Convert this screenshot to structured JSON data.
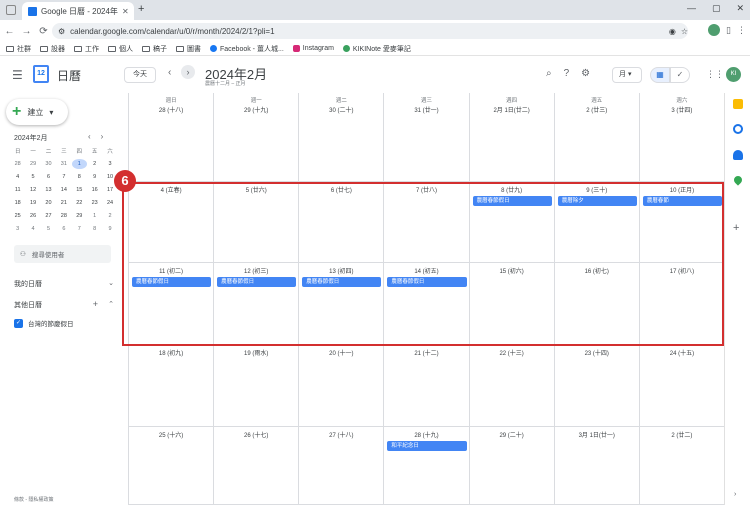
{
  "browser": {
    "tab_title": "Google 日曆 - 2024年2月",
    "tab_close": "✕",
    "new_tab": "+",
    "window_buttons": [
      "—",
      "▢",
      "✕"
    ],
    "back": "←",
    "forward": "→",
    "reload": "⟳",
    "url": "calendar.google.com/calendar/u/0/r/month/2024/2/1?pli=1",
    "bookmarks": [
      "社群",
      "設器",
      "工作",
      "個人",
      "稿子",
      "圖書",
      "Facebook - 薑人城...",
      "Instagram",
      "KIKINote 愛麥筆記"
    ]
  },
  "header": {
    "logo_text": "12",
    "app_title": "日曆",
    "today_label": "今天",
    "prev": "‹",
    "next": "›",
    "month_title": "2024年2月",
    "month_subtitle": "農曆十二月 – 正月",
    "view_label": "月 ▾",
    "avatar_text": "KI"
  },
  "sidebar": {
    "create_label": "建立",
    "mini_month": "2024年2月",
    "mini_prev": "‹",
    "mini_next": "›",
    "mini_dow": [
      "日",
      "一",
      "二",
      "三",
      "四",
      "五",
      "六"
    ],
    "mini_days": [
      [
        "28",
        "29",
        "30",
        "31",
        "1",
        "2",
        "3"
      ],
      [
        "4",
        "5",
        "6",
        "7",
        "8",
        "9",
        "10"
      ],
      [
        "11",
        "12",
        "13",
        "14",
        "15",
        "16",
        "17"
      ],
      [
        "18",
        "19",
        "20",
        "21",
        "22",
        "23",
        "24"
      ],
      [
        "25",
        "26",
        "27",
        "28",
        "29",
        "1",
        "2"
      ],
      [
        "3",
        "4",
        "5",
        "6",
        "7",
        "8",
        "9"
      ]
    ],
    "people_search": "搜尋使用者",
    "my_calendars": "我的日曆",
    "other_calendars": "其他日曆",
    "calendar_item": "台灣的節慶假日",
    "footer": "條款 - 隱私權政策"
  },
  "calendar": {
    "dow": [
      "週日",
      "週一",
      "週二",
      "週三",
      "週四",
      "週五",
      "週六"
    ],
    "weeks": [
      [
        "28 (十八)",
        "29 (十九)",
        "30 (二十)",
        "31 (廿一)",
        "2月 1日(廿二)",
        "2 (廿三)",
        "3 (廿四)"
      ],
      [
        "4 (立春)",
        "5 (廿六)",
        "6 (廿七)",
        "7 (廿八)",
        "8 (廿九)",
        "9 (三十)",
        "10 (正月)"
      ],
      [
        "11 (初二)",
        "12 (初三)",
        "13 (初四)",
        "14 (初五)",
        "15 (初六)",
        "16 (初七)",
        "17 (初八)"
      ],
      [
        "18 (初九)",
        "19 (雨水)",
        "20 (十一)",
        "21 (十二)",
        "22 (十三)",
        "23 (十四)",
        "24 (十五)"
      ],
      [
        "25 (十六)",
        "26 (十七)",
        "27 (十八)",
        "28 (十九)",
        "29 (二十)",
        "3月 1日(廿一)",
        "2 (廿二)"
      ]
    ],
    "events": [
      {
        "week": 1,
        "day": 4,
        "label": "農曆春節假日"
      },
      {
        "week": 1,
        "day": 5,
        "label": "農曆除夕"
      },
      {
        "week": 1,
        "day": 6,
        "label": "農曆春節"
      },
      {
        "week": 2,
        "day": 0,
        "label": "農曆春節假日"
      },
      {
        "week": 2,
        "day": 1,
        "label": "農曆春節假日"
      },
      {
        "week": 2,
        "day": 2,
        "label": "農曆春節假日"
      },
      {
        "week": 2,
        "day": 3,
        "label": "農曆春節假日"
      },
      {
        "week": 4,
        "day": 3,
        "label": "和平紀念日"
      }
    ]
  },
  "annotation": {
    "badge": "6"
  },
  "colors": {
    "accent": "#4285f4",
    "highlight": "#d32f2f"
  }
}
